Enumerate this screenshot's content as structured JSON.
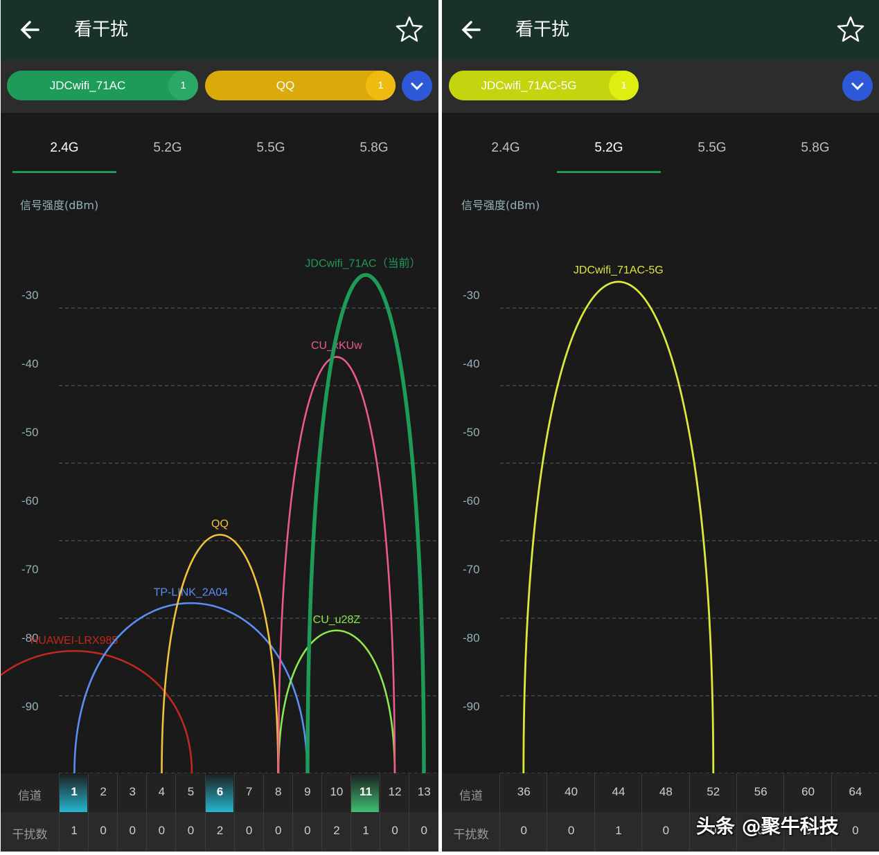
{
  "left": {
    "header": {
      "title": "看干扰"
    },
    "filters": [
      {
        "label": "JDCwifi_71AC",
        "count": "1",
        "color": "#1e9b58"
      },
      {
        "label": "QQ",
        "count": "1",
        "color": "#d9aa0a"
      }
    ],
    "tabs": [
      "2.4G",
      "5.2G",
      "5.5G",
      "5.8G"
    ],
    "active_tab": "2.4G",
    "chart_data": {
      "type": "line",
      "ylabel": "信号强度(dBm)",
      "y_ticks": [
        "-30",
        "-40",
        "-50",
        "-60",
        "-70",
        "-80",
        "-90"
      ],
      "x_label": "信道",
      "interference_label": "干扰数",
      "channels": [
        "1",
        "2",
        "3",
        "4",
        "5",
        "6",
        "7",
        "8",
        "9",
        "10",
        "11",
        "12",
        "13"
      ],
      "interference": [
        "1",
        "0",
        "0",
        "0",
        "0",
        "2",
        "0",
        "0",
        "0",
        "2",
        "1",
        "0",
        "0"
      ],
      "highlighted_channels": [
        "1",
        "6",
        "11"
      ],
      "networks": [
        {
          "name": "HUAWEI-LRX985",
          "channel": 1,
          "signal": -82,
          "color": "#c1281e"
        },
        {
          "name": "TP-LINK_2A04",
          "channel": 5,
          "signal": -75,
          "color": "#5b8ff5"
        },
        {
          "name": "QQ",
          "channel": 6,
          "signal": -65,
          "color": "#f4c238"
        },
        {
          "name": "CU_u28Z",
          "channel": 10,
          "signal": -79,
          "color": "#8de84c"
        },
        {
          "name": "CU_xKUw",
          "channel": 10,
          "signal": -39,
          "color": "#ec5b8a"
        },
        {
          "name": "JDCwifi_71AC（当前）",
          "channel": 11,
          "signal": -27,
          "color": "#1e9b58"
        }
      ]
    }
  },
  "right": {
    "header": {
      "title": "看干扰"
    },
    "filters": [
      {
        "label": "JDCwifi_71AC-5G",
        "count": "1",
        "color": "#c4d40e"
      }
    ],
    "tabs": [
      "2.4G",
      "5.2G",
      "5.5G",
      "5.8G"
    ],
    "active_tab": "5.2G",
    "chart_data": {
      "type": "line",
      "ylabel": "信号强度(dBm)",
      "y_ticks": [
        "-30",
        "-40",
        "-50",
        "-60",
        "-70",
        "-80",
        "-90"
      ],
      "x_label": "信道",
      "interference_label": "干扰数",
      "channels": [
        "36",
        "40",
        "44",
        "48",
        "52",
        "56",
        "60",
        "64"
      ],
      "interference": [
        "0",
        "0",
        "1",
        "0",
        "0",
        "0",
        "0",
        "0"
      ],
      "networks": [
        {
          "name": "JDCwifi_71AC-5G",
          "channel": 44,
          "signal": -28,
          "color": "#dce83a"
        }
      ]
    }
  },
  "watermark": "头条 @聚牛科技"
}
